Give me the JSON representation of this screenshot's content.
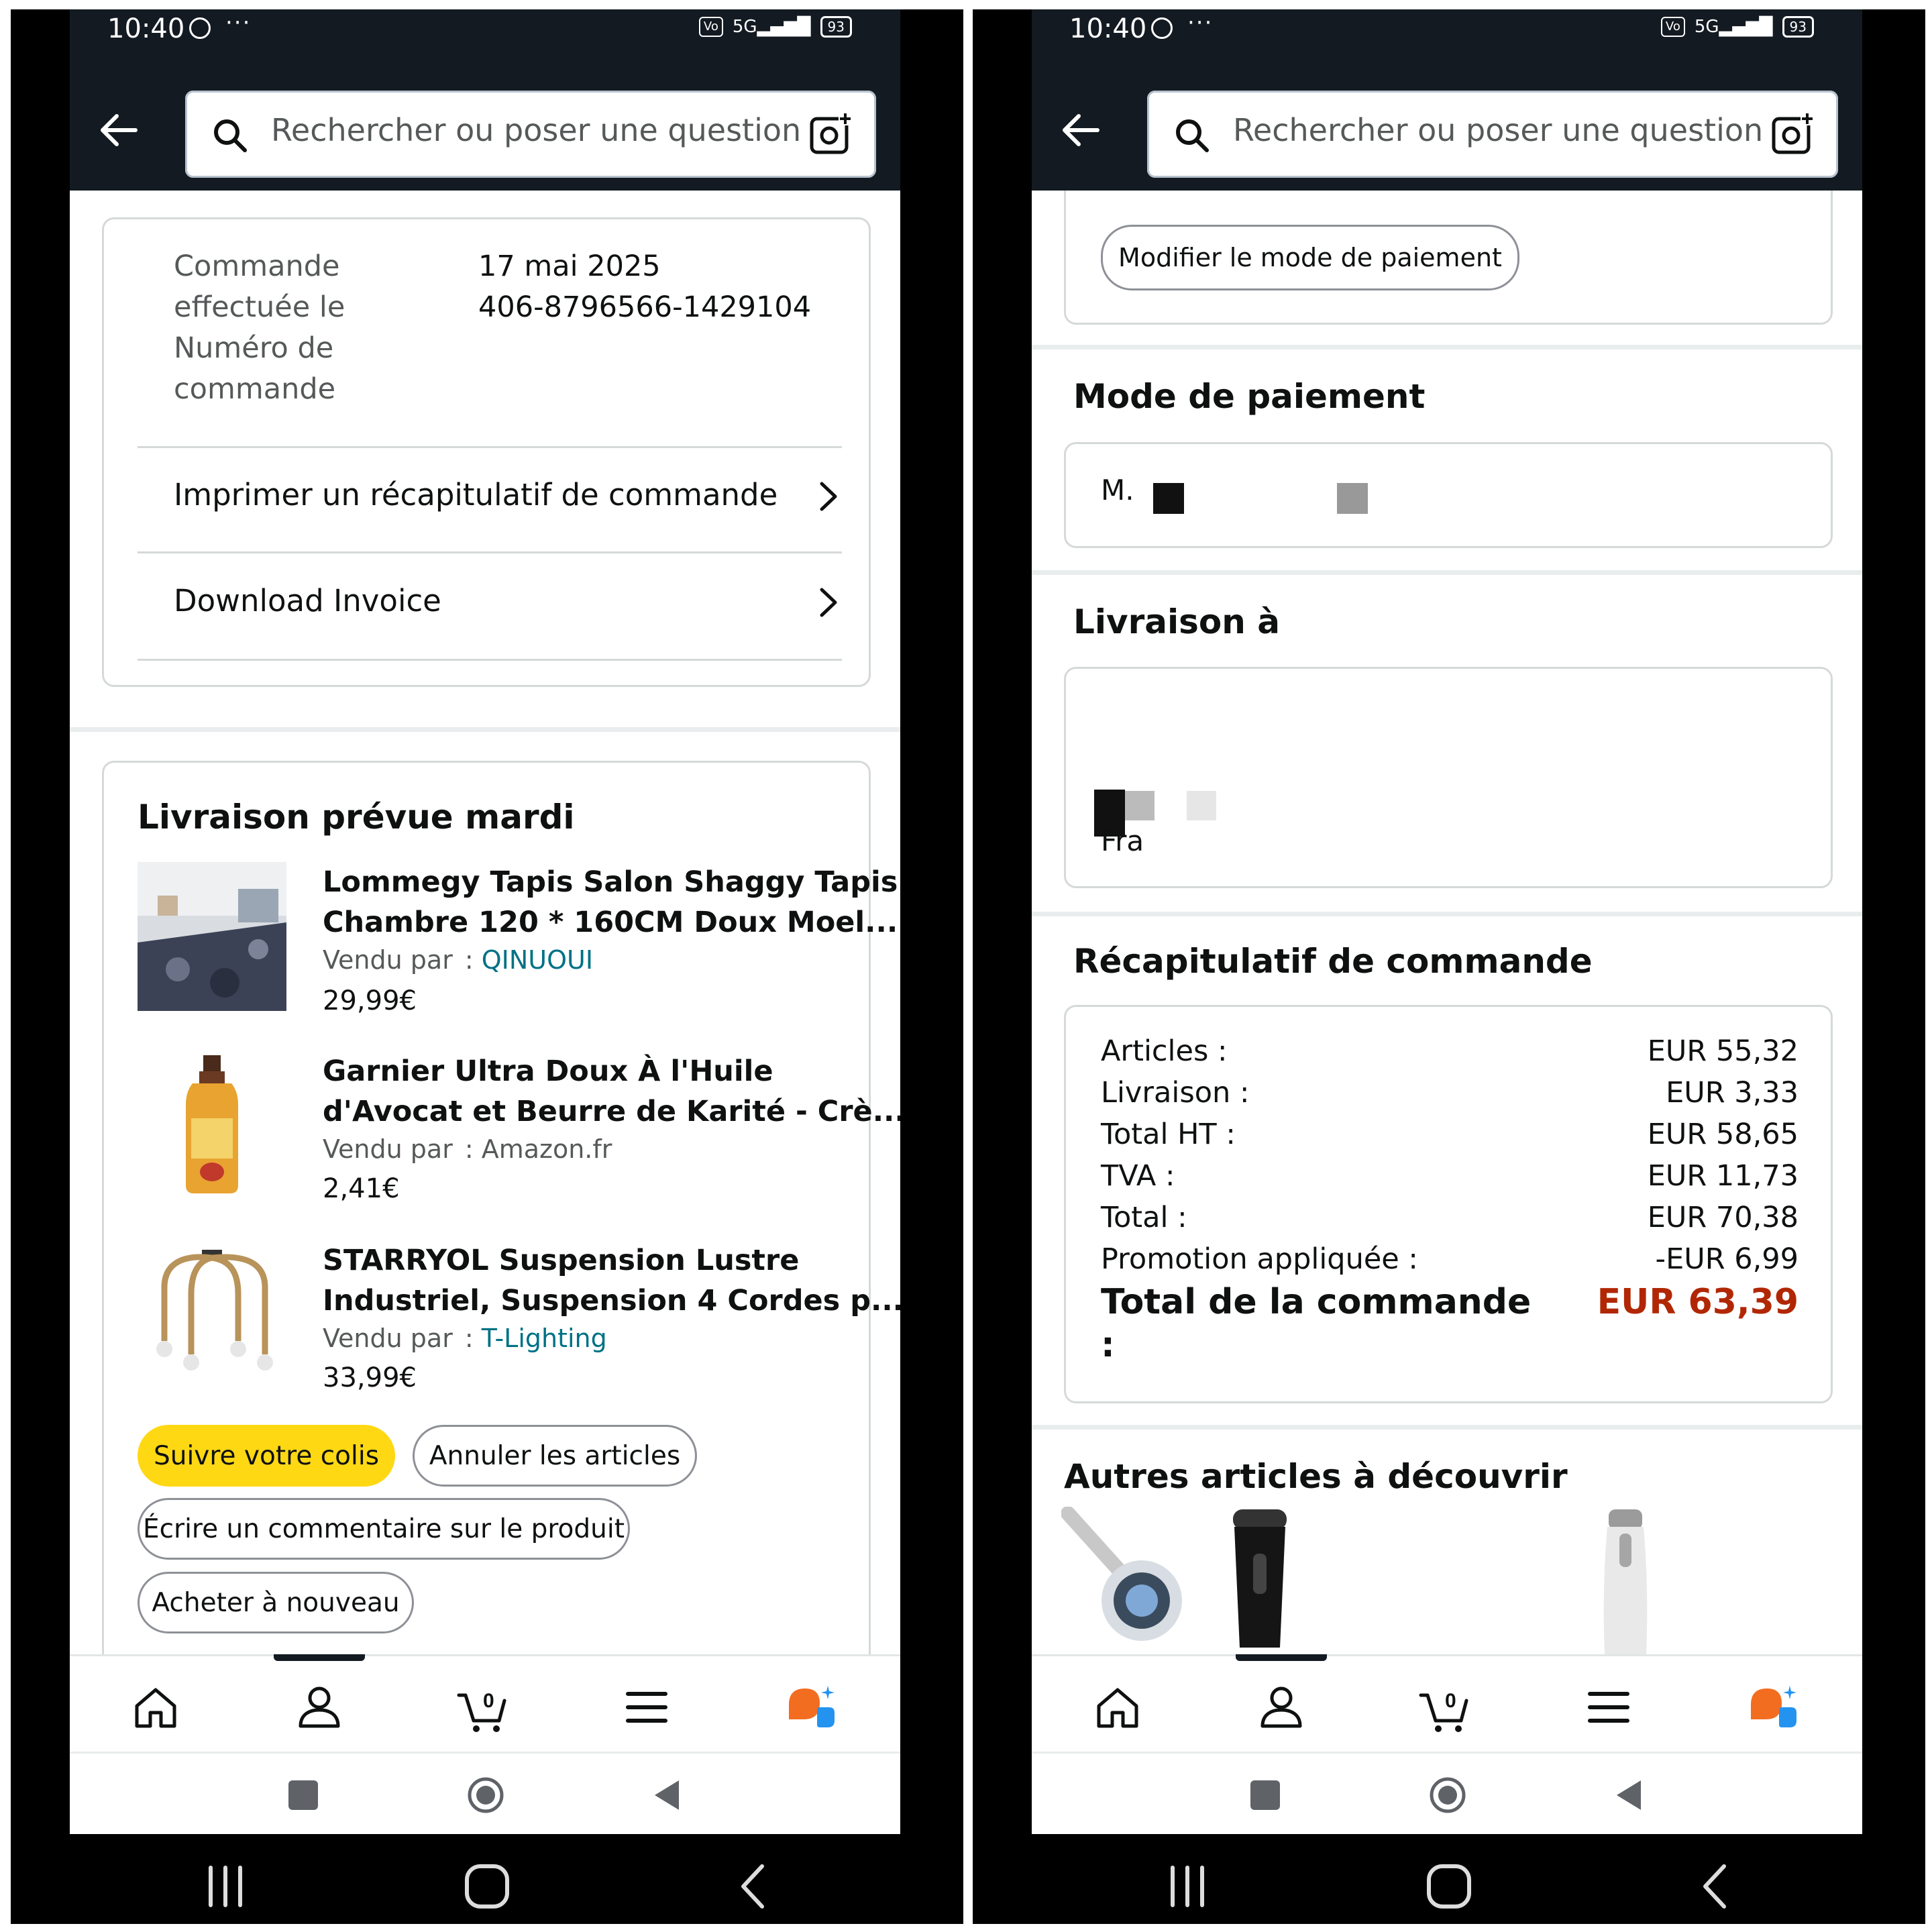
{
  "status_bar": {
    "time": "10:40",
    "dots": "···",
    "network": "5G",
    "battery": "93"
  },
  "search": {
    "placeholder": "Rechercher ou poser une question"
  },
  "left": {
    "order_date_label": [
      "Commande",
      "effectuée le"
    ],
    "order_number_label": [
      "Numéro de",
      "commande"
    ],
    "order_date": "17 mai 2025",
    "order_number": "406-8796566-1429104",
    "print_summary": "Imprimer un récapitulatif de commande",
    "download_invoice": "Download Invoice",
    "delivery_title": "Livraison prévue mardi",
    "seller_prefix": "Vendu par",
    "seller_colon": ":",
    "items": [
      {
        "title_1": "Lommegy Tapis Salon Shaggy Tapis",
        "title_2": "Chambre 120 * 160CM Doux Moel...",
        "seller": "QINUOUI",
        "price": "29,99€"
      },
      {
        "title_1": "Garnier Ultra Doux À l'Huile",
        "title_2": "d'Avocat et Beurre de Karité - Crè...",
        "seller": "Amazon.fr",
        "price": "2,41€"
      },
      {
        "title_1": "STARRYOL Suspension Lustre",
        "title_2": "Industriel, Suspension 4 Cordes p...",
        "seller": "T-Lighting",
        "price": "33,99€"
      }
    ],
    "buttons": {
      "track": "Suivre votre colis",
      "cancel": "Annuler les articles",
      "review": "Écrire un commentaire sur le produit",
      "buy_again": "Acheter à nouveau"
    }
  },
  "right": {
    "change_payment": "Modifier le mode de paiement",
    "payment_title": "Mode de paiement",
    "payment_partial": "M.",
    "delivery_title": "Livraison à",
    "delivery_partial": "Fra",
    "summary_title": "Récapitulatif de commande",
    "summary": [
      {
        "label": "Articles :",
        "value": "EUR 55,32"
      },
      {
        "label": "Livraison :",
        "value": "EUR 3,33"
      },
      {
        "label": "Total HT :",
        "value": "EUR 58,65"
      },
      {
        "label": "TVA :",
        "value": "EUR 11,73"
      },
      {
        "label": "Total :",
        "value": "EUR 70,38"
      },
      {
        "label": "Promotion appliquée :",
        "value": "-EUR 6,99"
      }
    ],
    "order_total_label_1": "Total de la commande",
    "order_total_label_2": ":",
    "order_total_value": "EUR 63,39",
    "discover_title": "Autres articles à découvrir"
  },
  "tabs": {
    "cart_count": "0"
  },
  "colors": {
    "header": "#131a22",
    "accent": "#ffd814",
    "link": "#007185",
    "price_red": "#b12704"
  }
}
